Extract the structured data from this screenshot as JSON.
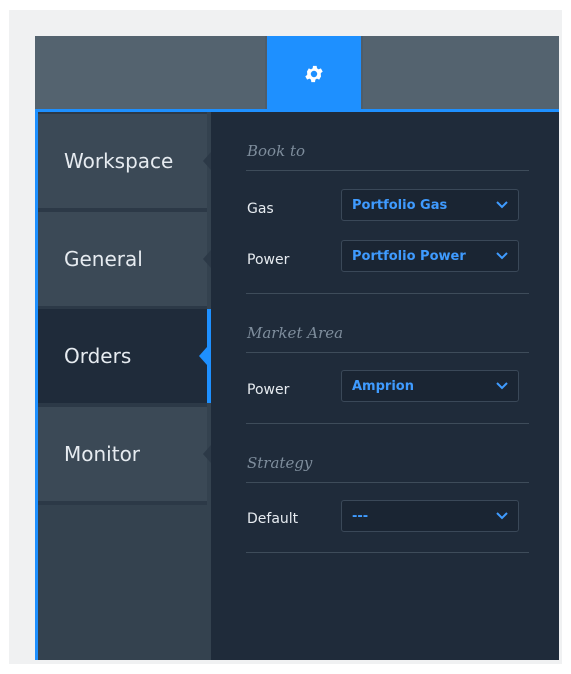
{
  "colors": {
    "accent": "#1e90ff",
    "panel_bg": "#1f2b3a",
    "tab_bg": "#3b4956",
    "select_text": "#3f9bff",
    "label_text": "#e6ebf0",
    "section_text": "#7e8d9c"
  },
  "topbar": {
    "active_icon": "gear-icon"
  },
  "sidebar": {
    "items": [
      {
        "label": "Workspace",
        "active": false
      },
      {
        "label": "General",
        "active": false
      },
      {
        "label": "Orders",
        "active": true
      },
      {
        "label": "Monitor",
        "active": false
      }
    ]
  },
  "sections": {
    "book_to": {
      "title": "Book to",
      "rows": [
        {
          "label": "Gas",
          "value": "Portfolio Gas"
        },
        {
          "label": "Power",
          "value": "Portfolio Power"
        }
      ]
    },
    "market_area": {
      "title": "Market Area",
      "rows": [
        {
          "label": "Power",
          "value": "Amprion"
        }
      ]
    },
    "strategy": {
      "title": "Strategy",
      "rows": [
        {
          "label": "Default",
          "value": "---"
        }
      ]
    }
  }
}
